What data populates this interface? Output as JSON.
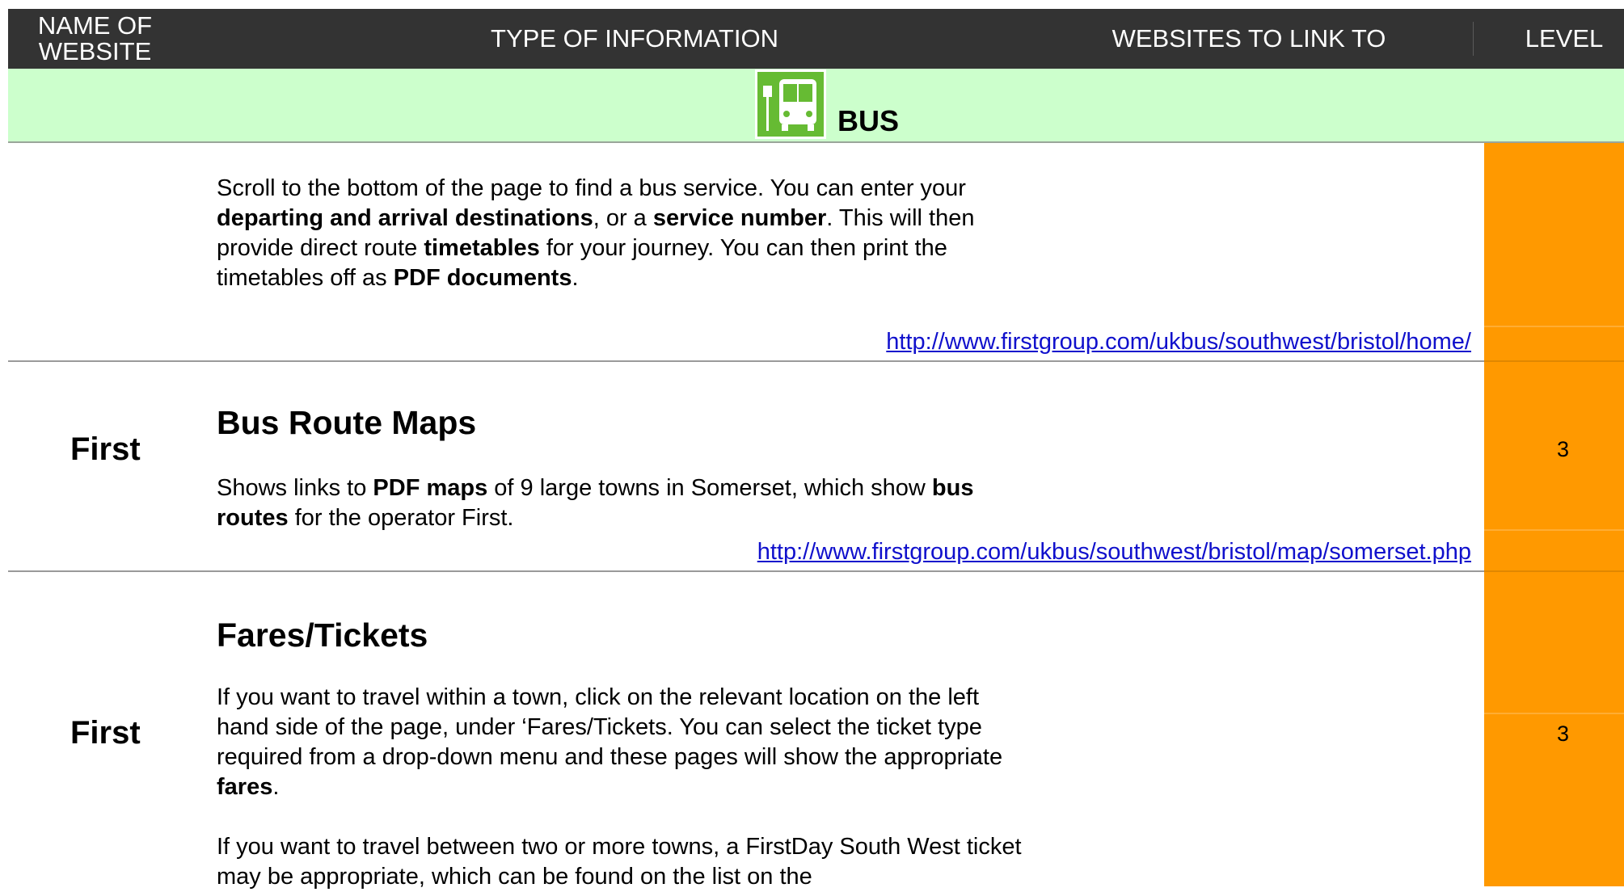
{
  "header": {
    "name_col": "NAME OF WEBSITE",
    "type_col": "TYPE OF INFORMATION",
    "links_col": "WEBSITES TO LINK TO",
    "level_col": "LEVEL"
  },
  "section": {
    "label": "BUS",
    "icon": "bus-icon",
    "band_color": "#ccffcc"
  },
  "colors": {
    "level_column": "#ff9900",
    "header": "#333333",
    "link": "#1010cc"
  },
  "rows": [
    {
      "name": "",
      "level": "",
      "link": "http://www.firstgroup.com/ukbus/southwest/bristol/home/",
      "segments": [
        [
          "Scroll to the bottom of the page to find a bus service. You can enter your ",
          false
        ],
        [
          "departing and arrival destinations",
          true
        ],
        [
          ", or a ",
          false
        ],
        [
          "service number",
          true
        ],
        [
          ". This will then provide direct route ",
          false
        ],
        [
          "timetables",
          true
        ],
        [
          " for your journey. You can then print the timetables off as ",
          false
        ],
        [
          "PDF documents",
          true
        ],
        [
          ".",
          false
        ]
      ]
    },
    {
      "name": "First",
      "level": "3",
      "title": "Bus Route Maps",
      "link": "http://www.firstgroup.com/ukbus/southwest/bristol/map/somerset.php",
      "segments": [
        [
          "Shows links to ",
          false
        ],
        [
          "PDF maps",
          true
        ],
        [
          " of 9 large towns in Somerset, which show ",
          false
        ],
        [
          "bus routes",
          true
        ],
        [
          " for the operator First.",
          false
        ]
      ]
    },
    {
      "name": "First",
      "level": "3",
      "title": "Fares/Tickets",
      "segments": [
        [
          "If you want to travel within a town, click on the relevant location on the left hand side of the page, under ‘Fares/Tickets. You can select the ticket type required from a drop-down menu and these pages will show the appropriate ",
          false
        ],
        [
          "fares",
          true
        ],
        [
          ".",
          false
        ]
      ],
      "segments2": [
        [
          "If you want to travel between two or more towns, a FirstDay South West ticket may be appropriate, which can be found on the list on the",
          false
        ]
      ]
    }
  ]
}
